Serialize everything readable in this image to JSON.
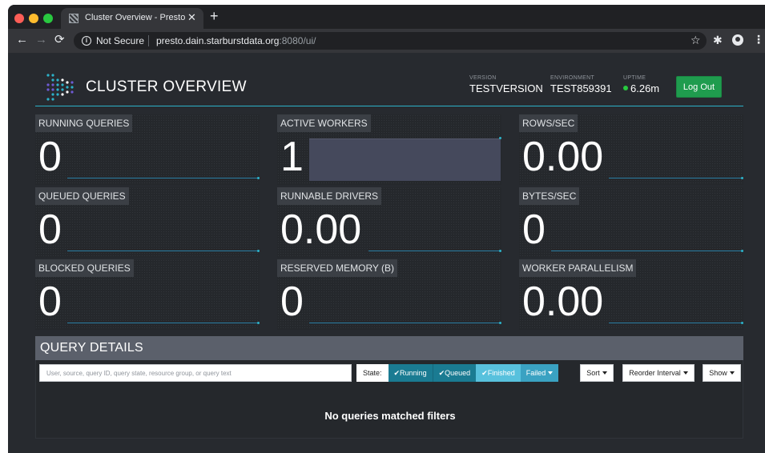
{
  "browser": {
    "tab_title": "Cluster Overview - Presto",
    "tab_close": "✕",
    "new_tab": "+",
    "security_label": "Not Secure",
    "url_host": "presto.dain.starburstdata.org",
    "url_port_path": ":8080/ui/"
  },
  "header": {
    "title": "CLUSTER OVERVIEW",
    "version_label": "VERSION",
    "version_value": "TESTVERSION",
    "environment_label": "ENVIRONMENT",
    "environment_value": "TEST859391",
    "uptime_label": "UPTIME",
    "uptime_value": "6.26m",
    "logout_label": "Log Out",
    "accent_color": "#2cb2c9",
    "logout_color": "#1f9c4e"
  },
  "stats": [
    {
      "label": "RUNNING QUERIES",
      "value": "0"
    },
    {
      "label": "ACTIVE WORKERS",
      "value": "1"
    },
    {
      "label": "ROWS/SEC",
      "value": "0.00"
    },
    {
      "label": "QUEUED QUERIES",
      "value": "0"
    },
    {
      "label": "RUNNABLE DRIVERS",
      "value": "0.00"
    },
    {
      "label": "BYTES/SEC",
      "value": "0"
    },
    {
      "label": "BLOCKED QUERIES",
      "value": "0"
    },
    {
      "label": "RESERVED MEMORY (B)",
      "value": "0"
    },
    {
      "label": "WORKER PARALLELISM",
      "value": "0.00"
    }
  ],
  "query_details": {
    "title": "QUERY DETAILS",
    "search_placeholder": "User, source, query ID, query state, resource group, or query text",
    "state_label": "State:",
    "states": {
      "running": "✔Running",
      "queued": "✔Queued",
      "finished": "✔Finished",
      "failed": "Failed"
    },
    "sort_label": "Sort",
    "reorder_label": "Reorder Interval",
    "show_label": "Show",
    "empty_message": "No queries matched filters"
  },
  "icons": {
    "back": "arrow-left-icon",
    "forward": "arrow-right-icon",
    "reload": "reload-icon",
    "info": "info-icon",
    "star": "star-icon",
    "extensions": "puzzle-icon",
    "profile": "profile-icon",
    "menu": "kebab-menu-icon",
    "logo": "presto-logo-icon"
  }
}
